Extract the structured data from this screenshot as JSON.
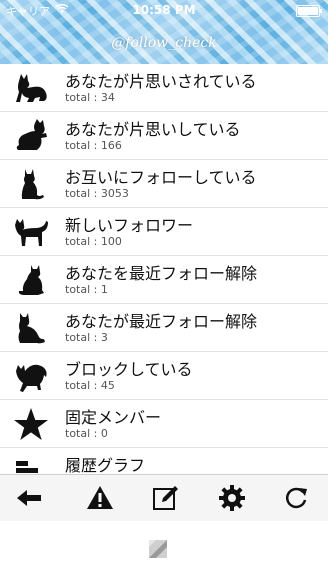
{
  "status_bar": {
    "carrier": "キャリア",
    "time": "10:58 PM"
  },
  "header": {
    "title": "@follow_check"
  },
  "list": [
    {
      "label": "あなたが片思いされている",
      "count": "total : 34",
      "icon": "cat-lying-icon"
    },
    {
      "label": "あなたが片思いしている",
      "count": "total : 166",
      "icon": "cat-pawing-icon"
    },
    {
      "label": "お互いにフォローしている",
      "count": "total : 3053",
      "icon": "cat-sitting-icon"
    },
    {
      "label": "新しいフォロワー",
      "count": "total : 100",
      "icon": "cat-walking-icon"
    },
    {
      "label": "あなたを最近フォロー解除",
      "count": "total : 1",
      "icon": "cat-sitting-back-icon"
    },
    {
      "label": "あなたが最近フォロー解除",
      "count": "total : 3",
      "icon": "cat-sitting-side-icon"
    },
    {
      "label": "ブロックしている",
      "count": "total : 45",
      "icon": "cat-arched-icon"
    },
    {
      "label": "固定メンバー",
      "count": "total : 0",
      "icon": "star-icon"
    },
    {
      "label": "履歴グラフ",
      "count": "",
      "icon": "bar-graph-icon"
    }
  ],
  "toolbar": {
    "items": [
      "back-arrow-icon",
      "warning-icon",
      "compose-icon",
      "gear-icon",
      "refresh-icon"
    ]
  },
  "colors": {
    "header": "#8ccbee",
    "icon": "#111111",
    "toolbar": "#f5f5f5"
  }
}
